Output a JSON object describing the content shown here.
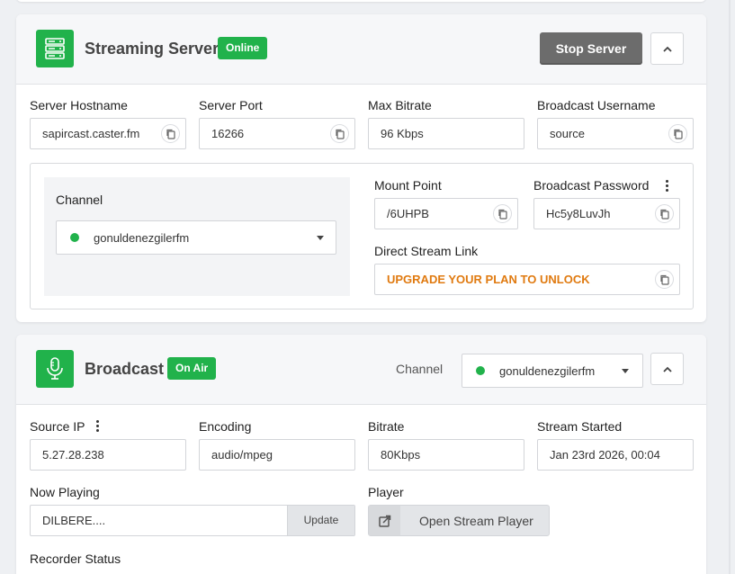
{
  "streaming_server": {
    "title": "Streaming Server",
    "status_badge": "Online",
    "stop_button": "Stop Server",
    "fields": [
      {
        "label": "Server Hostname",
        "value": "sapircast.caster.fm"
      },
      {
        "label": "Server Port",
        "value": "16266"
      },
      {
        "label": "Max Bitrate",
        "value": "96 Kbps"
      },
      {
        "label": "Broadcast Username",
        "value": "source"
      }
    ],
    "channel_label": "Channel",
    "channel_selected": "gonuldenezgilerfm",
    "mount_point": {
      "label": "Mount Point",
      "value": "/6UHPB"
    },
    "broadcast_password": {
      "label": "Broadcast Password",
      "value": "Hc5y8LuvJh"
    },
    "direct_stream": {
      "label": "Direct Stream Link",
      "value": "UPGRADE YOUR PLAN TO UNLOCK"
    }
  },
  "broadcast": {
    "title": "Broadcast",
    "status_badge": "On Air",
    "channel_label": "Channel",
    "channel_selected": "gonuldenezgilerfm",
    "fields": [
      {
        "label": "Source IP",
        "value": "5.27.28.238"
      },
      {
        "label": "Encoding",
        "value": "audio/mpeg"
      },
      {
        "label": "Bitrate",
        "value": "80Kbps"
      },
      {
        "label": "Stream Started",
        "value": "Jan 23rd 2026, 00:04"
      }
    ],
    "now_playing": {
      "label": "Now Playing",
      "value": "DILBERE....",
      "update_button": "Update"
    },
    "player": {
      "label": "Player",
      "button": "Open Stream Player"
    },
    "recorder_status_label": "Recorder Status"
  },
  "colors": {
    "accent_green": "#21b24b",
    "upgrade_orange": "#e07a10",
    "stop_gray": "#6c6c6c"
  },
  "icons": [
    "server-icon",
    "copy-icon",
    "microphone-icon",
    "chevron-up-icon",
    "caret-down-icon",
    "external-link-icon",
    "more-vertical-icon"
  ]
}
